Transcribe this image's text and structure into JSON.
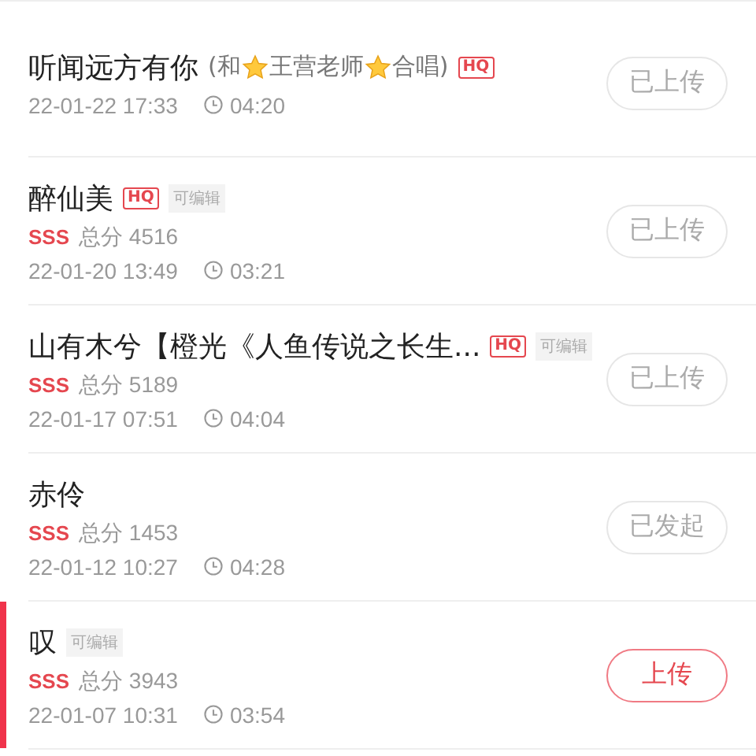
{
  "songs": [
    {
      "title": "听闻远方有你",
      "subtitle": [
        "(和",
        "王营老师",
        "合唱)"
      ],
      "badge": "HQ",
      "date": "22-01-22 17:33",
      "duration": "04:20",
      "action": {
        "label": "已上传",
        "kind": "done"
      },
      "selected": false
    },
    {
      "title": "醉仙美",
      "badge": "HQ",
      "edit_tag": "可编辑",
      "grade": "SSS",
      "score": "总分 4516",
      "date": "22-01-20 13:49",
      "duration": "03:21",
      "action": {
        "label": "已上传",
        "kind": "done"
      },
      "selected": false
    },
    {
      "title": "山有木兮【橙光《人鱼传说之长生...",
      "badge": "HQ",
      "edit_tag": "可编辑",
      "grade": "SSS",
      "score": "总分 5189",
      "date": "22-01-17 07:51",
      "duration": "04:04",
      "action": {
        "label": "已上传",
        "kind": "done"
      },
      "selected": false
    },
    {
      "title": "赤伶",
      "grade": "SSS",
      "score": "总分 1453",
      "date": "22-01-12 10:27",
      "duration": "04:28",
      "action": {
        "label": "已发起",
        "kind": "done"
      },
      "selected": false
    },
    {
      "title": "叹",
      "edit_tag": "可编辑",
      "grade": "SSS",
      "score": "总分 3943",
      "date": "22-01-07 10:31",
      "duration": "03:54",
      "action": {
        "label": "上传",
        "kind": "upload"
      },
      "selected": true
    }
  ]
}
